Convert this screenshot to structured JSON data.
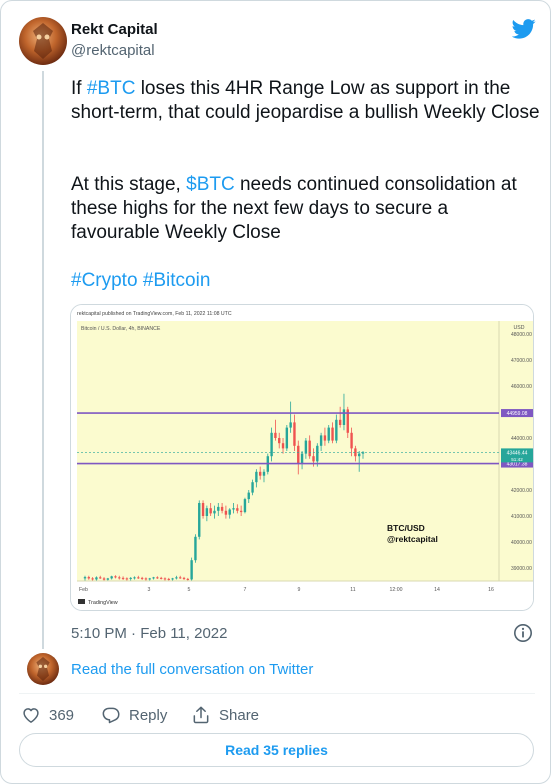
{
  "author": {
    "name": "Rekt Capital",
    "handle": "@rektcapital"
  },
  "tweet": {
    "p1": [
      {
        "text": "If ",
        "link": false
      },
      {
        "text": "#BTC",
        "link": true
      },
      {
        "text": " loses this 4HR Range Low as support in the short-term, that could jeopardise a bullish Weekly Close",
        "link": false
      }
    ],
    "p2": [
      {
        "text": "At this stage, ",
        "link": false
      },
      {
        "text": "$BTC",
        "link": true
      },
      {
        "text": " needs continued consolidation at these highs for the next few days to secure a favourable Weekly Close",
        "link": false
      }
    ],
    "p3": [
      {
        "text": "#Crypto",
        "link": true
      },
      {
        "text": " ",
        "link": false
      },
      {
        "text": "#Bitcoin",
        "link": true
      }
    ]
  },
  "chart": {
    "published": "rektcapital published on TradingView.com, Feb 11, 2022 11:08 UTC",
    "symbol": "Bitcoin / U.S. Dollar, 4h, BINANCE",
    "currency": "USD",
    "watermark": [
      "BTC/USD",
      "@rektcapital"
    ],
    "brand": "TradingView",
    "price_ticks": [
      "48000.00",
      "47000.00",
      "46000.00",
      "45000.00",
      "44000.00",
      "43000.00",
      "42000.00",
      "41000.00",
      "40000.00",
      "39000.00"
    ],
    "levels": [
      {
        "value": 44959.08,
        "label": "44959.08"
      },
      {
        "value": 43017.38,
        "label": "43017.38"
      }
    ],
    "last_price_label": "43446.44",
    "last_timer_label": "51:42",
    "time_ticks": [
      "Feb",
      "3",
      "5",
      "7",
      "9",
      "11",
      "12:00",
      "14",
      "16"
    ],
    "ylim": [
      38500,
      48500
    ],
    "colors": {
      "up": "#26a69a",
      "down": "#ef5350",
      "level": "#7e57c2",
      "bg": "#fbfbcf"
    }
  },
  "chart_data": {
    "type": "candlestick",
    "title": "Bitcoin / U.S. Dollar, 4h, BINANCE",
    "ylim": [
      38500,
      48500
    ],
    "candles": [
      [
        38600,
        38700,
        38500,
        38650
      ],
      [
        38650,
        38700,
        38550,
        38600
      ],
      [
        38600,
        38650,
        38500,
        38560
      ],
      [
        38560,
        38680,
        38520,
        38640
      ],
      [
        38640,
        38700,
        38580,
        38600
      ],
      [
        38600,
        38650,
        38500,
        38550
      ],
      [
        38550,
        38620,
        38500,
        38600
      ],
      [
        38600,
        38700,
        38560,
        38680
      ],
      [
        38680,
        38720,
        38600,
        38640
      ],
      [
        38640,
        38700,
        38560,
        38620
      ],
      [
        38620,
        38680,
        38540,
        38600
      ],
      [
        38600,
        38640,
        38500,
        38580
      ],
      [
        38580,
        38650,
        38520,
        38620
      ],
      [
        38620,
        38680,
        38560,
        38640
      ],
      [
        38640,
        38700,
        38580,
        38620
      ],
      [
        38620,
        38660,
        38540,
        38600
      ],
      [
        38600,
        38640,
        38500,
        38560
      ],
      [
        38560,
        38620,
        38520,
        38600
      ],
      [
        38600,
        38660,
        38560,
        38640
      ],
      [
        38640,
        38680,
        38580,
        38620
      ],
      [
        38620,
        38660,
        38560,
        38600
      ],
      [
        38600,
        38640,
        38520,
        38580
      ],
      [
        38580,
        38620,
        38500,
        38560
      ],
      [
        38560,
        38620,
        38520,
        38600
      ],
      [
        38600,
        38700,
        38560,
        38640
      ],
      [
        38640,
        38700,
        38580,
        38620
      ],
      [
        38620,
        38660,
        38540,
        38580
      ],
      [
        38580,
        38620,
        38500,
        38560
      ],
      [
        38560,
        39400,
        38520,
        39300
      ],
      [
        39300,
        40300,
        39200,
        40200
      ],
      [
        40200,
        41600,
        40100,
        41500
      ],
      [
        41500,
        41600,
        40900,
        41000
      ],
      [
        41000,
        41400,
        40800,
        41300
      ],
      [
        41300,
        41500,
        41000,
        41100
      ],
      [
        41100,
        41400,
        40900,
        41200
      ],
      [
        41200,
        41500,
        41000,
        41350
      ],
      [
        41350,
        41500,
        41100,
        41200
      ],
      [
        41200,
        41400,
        40900,
        41050
      ],
      [
        41050,
        41300,
        40900,
        41250
      ],
      [
        41250,
        41500,
        41100,
        41300
      ],
      [
        41300,
        41450,
        41100,
        41200
      ],
      [
        41200,
        41400,
        41000,
        41150
      ],
      [
        41150,
        41700,
        41100,
        41650
      ],
      [
        41650,
        42000,
        41500,
        41900
      ],
      [
        41900,
        42400,
        41800,
        42300
      ],
      [
        42300,
        42800,
        42100,
        42700
      ],
      [
        42700,
        42900,
        42400,
        42550
      ],
      [
        42550,
        42800,
        42300,
        42700
      ],
      [
        42700,
        43400,
        42600,
        43300
      ],
      [
        43300,
        44400,
        43100,
        44200
      ],
      [
        44200,
        44700,
        43900,
        44000
      ],
      [
        44000,
        44200,
        43600,
        43800
      ],
      [
        43800,
        44000,
        43400,
        43600
      ],
      [
        43600,
        44500,
        43500,
        44400
      ],
      [
        44400,
        45400,
        44200,
        44600
      ],
      [
        44600,
        44900,
        43500,
        43700
      ],
      [
        43700,
        43900,
        42600,
        43000
      ],
      [
        43000,
        43500,
        42800,
        43400
      ],
      [
        43400,
        44000,
        43200,
        43900
      ],
      [
        43900,
        44100,
        43200,
        43300
      ],
      [
        43300,
        43600,
        42900,
        43100
      ],
      [
        43100,
        43800,
        42900,
        43700
      ],
      [
        43700,
        44200,
        43500,
        44100
      ],
      [
        44100,
        44400,
        43700,
        43900
      ],
      [
        43900,
        44500,
        43800,
        44400
      ],
      [
        44400,
        44600,
        43800,
        43900
      ],
      [
        43900,
        44900,
        43800,
        44700
      ],
      [
        44700,
        45200,
        44400,
        44500
      ],
      [
        44500,
        45700,
        44300,
        45100
      ],
      [
        45100,
        45200,
        44000,
        44200
      ],
      [
        44200,
        44400,
        43300,
        43600
      ],
      [
        43600,
        43700,
        43100,
        43300
      ],
      [
        43300,
        43500,
        42700,
        43400
      ],
      [
        43400,
        43500,
        43200,
        43450
      ]
    ],
    "levels": [
      44959.08,
      43017.38
    ]
  },
  "meta": {
    "timestamp": "5:10 PM · Feb 11, 2022",
    "read_conversation": "Read the full conversation on Twitter"
  },
  "actions": {
    "likes": "369",
    "reply": "Reply",
    "share": "Share",
    "read_replies": "Read 35 replies"
  }
}
